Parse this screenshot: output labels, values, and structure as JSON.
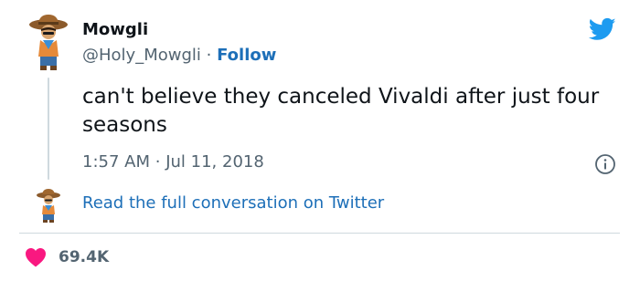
{
  "tweet": {
    "display_name": "Mowgli",
    "handle": "@Holy_Mowgli",
    "separator": "·",
    "follow_label": "Follow",
    "text": "can't believe they canceled Vivaldi after just four seasons",
    "time": "1:57 AM",
    "date_separator": "·",
    "date": "Jul 11, 2018",
    "read_conversation_label": "Read the full conversation on Twitter",
    "like_count": "69.4K"
  },
  "icons": {
    "brand": "twitter-bird-icon",
    "info": "info-icon",
    "like": "heart-icon"
  },
  "colors": {
    "link_blue": "#1d6fb8",
    "twitter_blue": "#1d9bf0",
    "heart_red": "#f91880",
    "muted_text": "#536471",
    "primary_text": "#0f1419",
    "divider": "#cfd9de"
  }
}
